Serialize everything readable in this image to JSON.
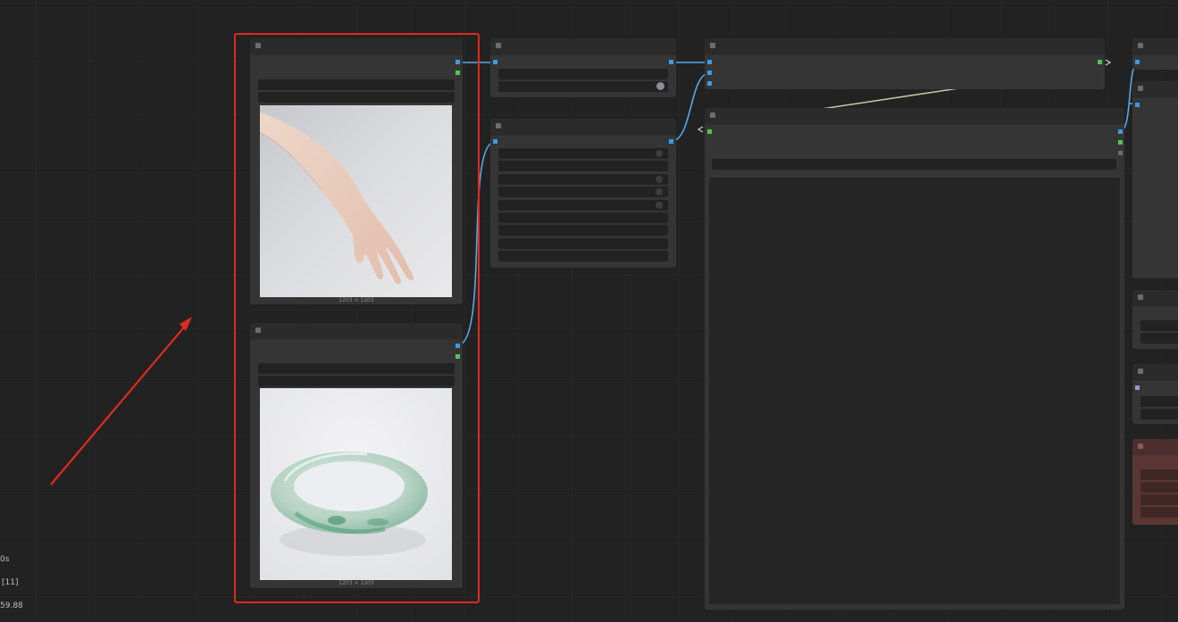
{
  "canvas": {
    "background": "#222222",
    "link_color": "#5aa7e8",
    "highlight_color": "#e12a1f"
  },
  "nodes": {
    "load_image_top": {
      "caption": "1203 × 1203",
      "preview": "hand-photo"
    },
    "load_image_bottom": {
      "caption": "1203 × 1203",
      "preview": "jade-bangle-photo"
    }
  },
  "status": {
    "line1": "0s",
    "line2": "[11]",
    "line3": "59.88"
  },
  "icons": [
    "node-collapse-dot-icon",
    "toggle-knob-icon",
    "arrow-annotation-icon"
  ]
}
